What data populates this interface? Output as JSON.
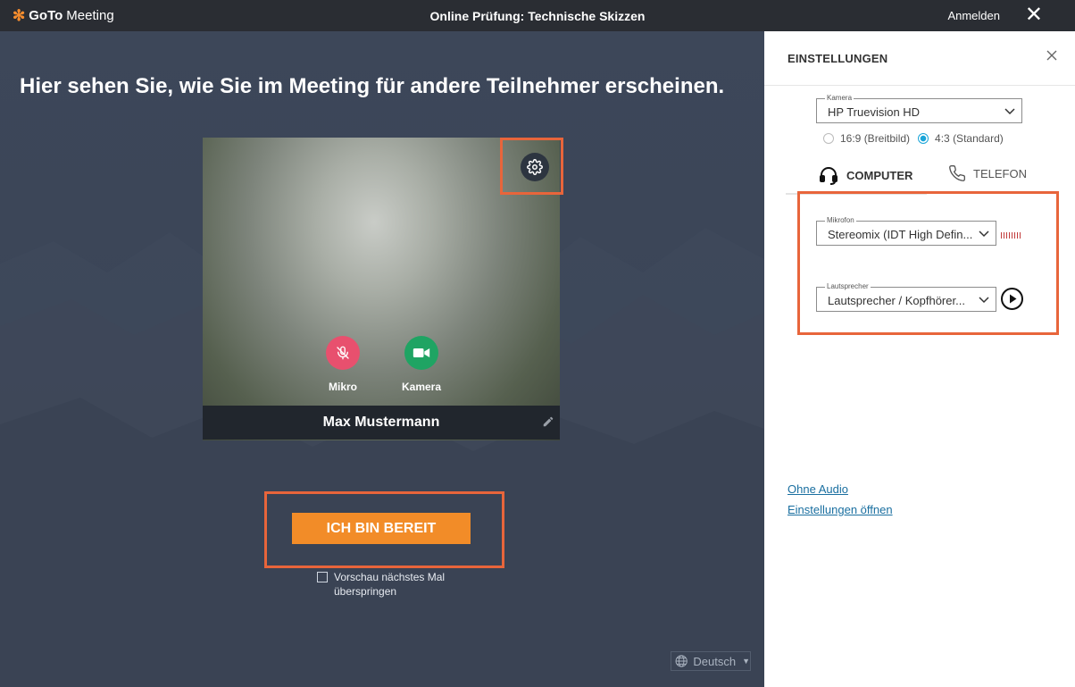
{
  "titlebar": {
    "brand_bold": "GoTo",
    "brand_light": "Meeting",
    "title": "Online Prüfung: Technische Skizzen",
    "signin": "Anmelden",
    "close": "✕"
  },
  "main": {
    "headline": "Hier sehen Sie, wie Sie im Meeting für andere Teilnehmer erscheinen.",
    "controls": {
      "mic_label": "Mikro",
      "camera_label": "Kamera"
    },
    "participant_name": "Max Mustermann",
    "ready_button": "ICH BIN BEREIT",
    "skip_preview": "Vorschau nächstes Mal überspringen",
    "language": "Deutsch"
  },
  "settings": {
    "title": "EINSTELLUNGEN",
    "camera": {
      "legend": "Kamera",
      "value": "HP Truevision HD"
    },
    "aspect": {
      "option_a": "16:9 (Breitbild)",
      "option_b": "4:3 (Standard)",
      "selected": "4:3 (Standard)"
    },
    "tabs": {
      "computer": "COMPUTER",
      "phone": "TELEFON",
      "active": "COMPUTER"
    },
    "microphone": {
      "legend": "Mikrofon",
      "value": "Stereomix (IDT High Defin..."
    },
    "speaker": {
      "legend": "Lautsprecher",
      "value": "Lautsprecher / Kopfhörer..."
    },
    "no_audio_link": "Ohne Audio",
    "open_settings_link": "Einstellungen öffnen"
  },
  "colors": {
    "accent_orange": "#f28c28",
    "highlight": "#e8653b",
    "mic_button": "#e8506e",
    "camera_button": "#1fa463",
    "radio_selected": "#1aa5d8"
  },
  "icons": {
    "logo": "gotomeeting-star-icon",
    "gear": "gear-icon",
    "mic": "microphone-muted-icon",
    "camera": "video-camera-icon",
    "edit": "pencil-icon",
    "globe": "globe-icon",
    "headset": "headset-icon",
    "phone": "phone-icon",
    "play": "play-icon"
  }
}
